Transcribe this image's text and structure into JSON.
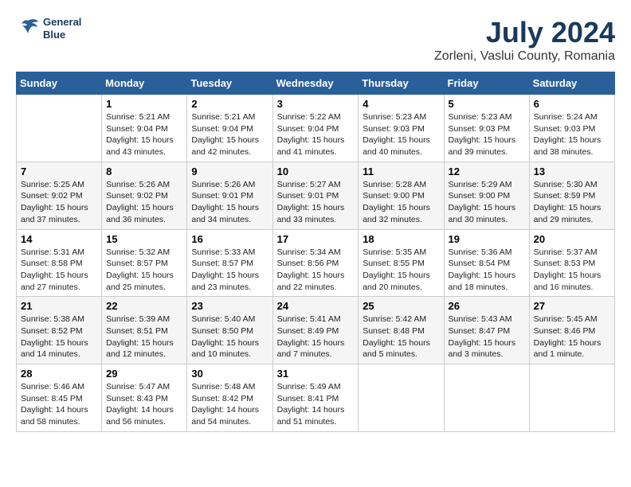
{
  "header": {
    "logo_line1": "General",
    "logo_line2": "Blue",
    "title": "July 2024",
    "subtitle": "Zorleni, Vaslui County, Romania"
  },
  "calendar": {
    "days_of_week": [
      "Sunday",
      "Monday",
      "Tuesday",
      "Wednesday",
      "Thursday",
      "Friday",
      "Saturday"
    ],
    "weeks": [
      [
        {
          "day": "",
          "content": ""
        },
        {
          "day": "1",
          "content": "Sunrise: 5:21 AM\nSunset: 9:04 PM\nDaylight: 15 hours\nand 43 minutes."
        },
        {
          "day": "2",
          "content": "Sunrise: 5:21 AM\nSunset: 9:04 PM\nDaylight: 15 hours\nand 42 minutes."
        },
        {
          "day": "3",
          "content": "Sunrise: 5:22 AM\nSunset: 9:04 PM\nDaylight: 15 hours\nand 41 minutes."
        },
        {
          "day": "4",
          "content": "Sunrise: 5:23 AM\nSunset: 9:03 PM\nDaylight: 15 hours\nand 40 minutes."
        },
        {
          "day": "5",
          "content": "Sunrise: 5:23 AM\nSunset: 9:03 PM\nDaylight: 15 hours\nand 39 minutes."
        },
        {
          "day": "6",
          "content": "Sunrise: 5:24 AM\nSunset: 9:03 PM\nDaylight: 15 hours\nand 38 minutes."
        }
      ],
      [
        {
          "day": "7",
          "content": "Sunrise: 5:25 AM\nSunset: 9:02 PM\nDaylight: 15 hours\nand 37 minutes."
        },
        {
          "day": "8",
          "content": "Sunrise: 5:26 AM\nSunset: 9:02 PM\nDaylight: 15 hours\nand 36 minutes."
        },
        {
          "day": "9",
          "content": "Sunrise: 5:26 AM\nSunset: 9:01 PM\nDaylight: 15 hours\nand 34 minutes."
        },
        {
          "day": "10",
          "content": "Sunrise: 5:27 AM\nSunset: 9:01 PM\nDaylight: 15 hours\nand 33 minutes."
        },
        {
          "day": "11",
          "content": "Sunrise: 5:28 AM\nSunset: 9:00 PM\nDaylight: 15 hours\nand 32 minutes."
        },
        {
          "day": "12",
          "content": "Sunrise: 5:29 AM\nSunset: 9:00 PM\nDaylight: 15 hours\nand 30 minutes."
        },
        {
          "day": "13",
          "content": "Sunrise: 5:30 AM\nSunset: 8:59 PM\nDaylight: 15 hours\nand 29 minutes."
        }
      ],
      [
        {
          "day": "14",
          "content": "Sunrise: 5:31 AM\nSunset: 8:58 PM\nDaylight: 15 hours\nand 27 minutes."
        },
        {
          "day": "15",
          "content": "Sunrise: 5:32 AM\nSunset: 8:57 PM\nDaylight: 15 hours\nand 25 minutes."
        },
        {
          "day": "16",
          "content": "Sunrise: 5:33 AM\nSunset: 8:57 PM\nDaylight: 15 hours\nand 23 minutes."
        },
        {
          "day": "17",
          "content": "Sunrise: 5:34 AM\nSunset: 8:56 PM\nDaylight: 15 hours\nand 22 minutes."
        },
        {
          "day": "18",
          "content": "Sunrise: 5:35 AM\nSunset: 8:55 PM\nDaylight: 15 hours\nand 20 minutes."
        },
        {
          "day": "19",
          "content": "Sunrise: 5:36 AM\nSunset: 8:54 PM\nDaylight: 15 hours\nand 18 minutes."
        },
        {
          "day": "20",
          "content": "Sunrise: 5:37 AM\nSunset: 8:53 PM\nDaylight: 15 hours\nand 16 minutes."
        }
      ],
      [
        {
          "day": "21",
          "content": "Sunrise: 5:38 AM\nSunset: 8:52 PM\nDaylight: 15 hours\nand 14 minutes."
        },
        {
          "day": "22",
          "content": "Sunrise: 5:39 AM\nSunset: 8:51 PM\nDaylight: 15 hours\nand 12 minutes."
        },
        {
          "day": "23",
          "content": "Sunrise: 5:40 AM\nSunset: 8:50 PM\nDaylight: 15 hours\nand 10 minutes."
        },
        {
          "day": "24",
          "content": "Sunrise: 5:41 AM\nSunset: 8:49 PM\nDaylight: 15 hours\nand 7 minutes."
        },
        {
          "day": "25",
          "content": "Sunrise: 5:42 AM\nSunset: 8:48 PM\nDaylight: 15 hours\nand 5 minutes."
        },
        {
          "day": "26",
          "content": "Sunrise: 5:43 AM\nSunset: 8:47 PM\nDaylight: 15 hours\nand 3 minutes."
        },
        {
          "day": "27",
          "content": "Sunrise: 5:45 AM\nSunset: 8:46 PM\nDaylight: 15 hours\nand 1 minute."
        }
      ],
      [
        {
          "day": "28",
          "content": "Sunrise: 5:46 AM\nSunset: 8:45 PM\nDaylight: 14 hours\nand 58 minutes."
        },
        {
          "day": "29",
          "content": "Sunrise: 5:47 AM\nSunset: 8:43 PM\nDaylight: 14 hours\nand 56 minutes."
        },
        {
          "day": "30",
          "content": "Sunrise: 5:48 AM\nSunset: 8:42 PM\nDaylight: 14 hours\nand 54 minutes."
        },
        {
          "day": "31",
          "content": "Sunrise: 5:49 AM\nSunset: 8:41 PM\nDaylight: 14 hours\nand 51 minutes."
        },
        {
          "day": "",
          "content": ""
        },
        {
          "day": "",
          "content": ""
        },
        {
          "day": "",
          "content": ""
        }
      ]
    ]
  }
}
